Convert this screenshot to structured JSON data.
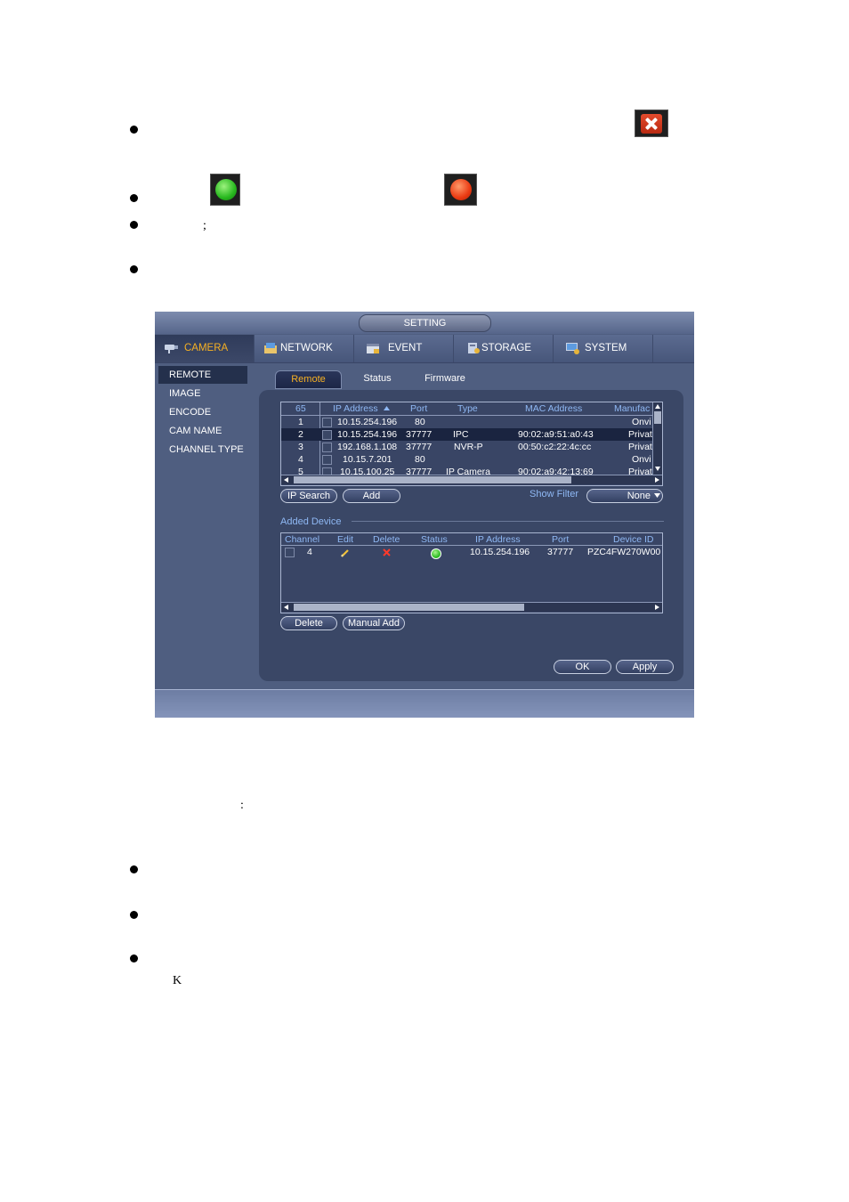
{
  "doc": {
    "semicolon_1": ";",
    "colon_1": ":",
    "letter_k": "K"
  },
  "icons": {
    "delete_x": "close-icon",
    "online_dot": {
      "name": "green-status-icon",
      "color": "#27b81e"
    },
    "offline_dot": {
      "name": "red-status-icon",
      "color": "#ea3a12"
    }
  },
  "window": {
    "title": "SETTING",
    "menu": [
      {
        "label": "CAMERA",
        "active": true
      },
      {
        "label": "NETWORK"
      },
      {
        "label": "EVENT"
      },
      {
        "label": "STORAGE"
      },
      {
        "label": "SYSTEM"
      }
    ],
    "sidebar": [
      "REMOTE",
      "IMAGE",
      "ENCODE",
      "CAM NAME",
      "CHANNEL TYPE"
    ],
    "subtabs": [
      "Remote",
      "Status",
      "Firmware"
    ],
    "search_table": {
      "headers": [
        "65",
        "IP Address",
        "Port",
        "Type",
        "MAC Address",
        "Manufac"
      ],
      "rows": [
        {
          "no": "1",
          "ip": "10.15.254.196",
          "port": "80",
          "type": "",
          "mac": "",
          "manu": "Onvi"
        },
        {
          "no": "2",
          "ip": "10.15.254.196",
          "port": "37777",
          "type": "IPC",
          "mac": "90:02:a9:51:a0:43",
          "manu": "Privat"
        },
        {
          "no": "3",
          "ip": "192.168.1.108",
          "port": "37777",
          "type": "NVR-P",
          "mac": "00:50:c2:22:4c:cc",
          "manu": "Privat"
        },
        {
          "no": "4",
          "ip": "10.15.7.201",
          "port": "80",
          "type": "",
          "mac": "",
          "manu": "Onvi"
        },
        {
          "no": "5",
          "ip": "10.15.100.25",
          "port": "37777",
          "type": "IP Camera",
          "mac": "90:02:a9:42:13:69",
          "manu": "Privat"
        }
      ]
    },
    "buttons": {
      "ip_search": "IP Search",
      "add": "Add",
      "show_filter": "Show Filter",
      "filter_value": "None",
      "delete": "Delete",
      "manual_add": "Manual Add",
      "ok": "OK",
      "apply": "Apply"
    },
    "added_device": {
      "title": "Added Device",
      "headers": [
        "Channel",
        "Edit",
        "Delete",
        "Status",
        "IP Address",
        "Port",
        "Device ID"
      ],
      "rows": [
        {
          "channel": "4",
          "ip": "10.15.254.196",
          "port": "37777",
          "device_id": "PZC4FW270W00"
        }
      ]
    }
  }
}
